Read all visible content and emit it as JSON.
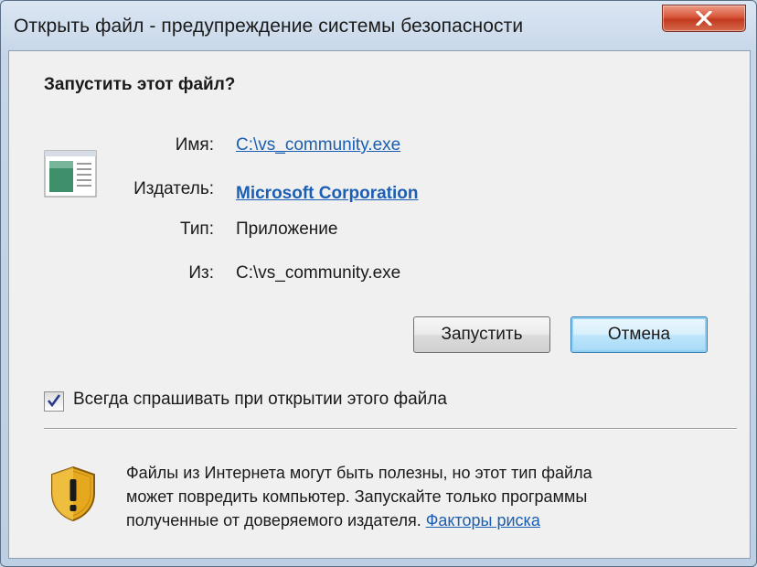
{
  "window": {
    "title": "Открыть файл - предупреждение системы безопасности"
  },
  "dialog": {
    "question": "Запустить этот файл?",
    "fields": {
      "name_label": "Имя:",
      "name_value": "C:\\vs_community.exe",
      "publisher_label": "Издатель:",
      "publisher_value": "Microsoft Corporation",
      "type_label": "Тип:",
      "type_value": "Приложение",
      "from_label": "Из:",
      "from_value": "C:\\vs_community.exe"
    },
    "buttons": {
      "run": "Запустить",
      "cancel": "Отмена"
    },
    "checkbox": {
      "label": "Всегда спрашивать при открытии этого файла",
      "checked": true
    },
    "warning": {
      "line1": "Файлы из Интернета могут быть полезны, но этот тип файла",
      "line2": "может повредить компьютер. Запускайте только программы",
      "line3": "полученные от доверяемого издателя.",
      "link": "Факторы риска"
    }
  },
  "icons": {
    "close": "close-icon",
    "file": "application-file-icon",
    "checkbox": "checkmark-icon",
    "shield": "security-shield-icon"
  },
  "colors": {
    "link": "#1a5fb4",
    "close_button": "#c23a1f",
    "default_button_border": "#3c7fb1"
  }
}
